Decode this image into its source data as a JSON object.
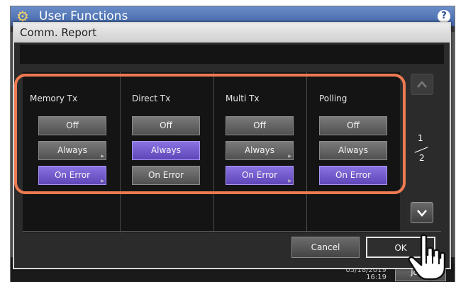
{
  "app": {
    "title": "User Functions",
    "help_label": "?"
  },
  "status": {
    "date": "05/18/2019",
    "time": "16:19",
    "job_status": "Job S"
  },
  "dialog": {
    "title": "Comm. Report",
    "info": "",
    "columns": [
      {
        "label": "Memory Tx",
        "options": [
          {
            "label": "Off",
            "selected": false
          },
          {
            "label": "Always",
            "selected": false
          },
          {
            "label": "On Error",
            "selected": true
          }
        ]
      },
      {
        "label": "Direct Tx",
        "options": [
          {
            "label": "Off",
            "selected": false
          },
          {
            "label": "Always",
            "selected": true
          },
          {
            "label": "On Error",
            "selected": false
          }
        ]
      },
      {
        "label": "Multi Tx",
        "options": [
          {
            "label": "Off",
            "selected": false
          },
          {
            "label": "Always",
            "selected": false
          },
          {
            "label": "On Error",
            "selected": true
          }
        ]
      },
      {
        "label": "Polling",
        "options": [
          {
            "label": "Off",
            "selected": false
          },
          {
            "label": "Always",
            "selected": false
          },
          {
            "label": "On Error",
            "selected": true
          }
        ]
      }
    ],
    "pager": {
      "current": "1",
      "total": "2"
    },
    "cancel_label": "Cancel",
    "ok_label": "OK"
  },
  "colors": {
    "selected": "#6a52c8",
    "highlight": "#ef7a52"
  }
}
